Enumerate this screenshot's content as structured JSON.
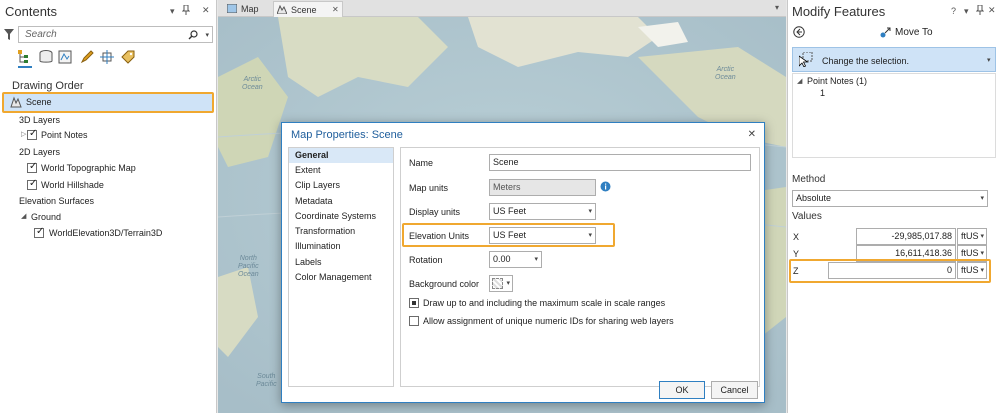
{
  "contents": {
    "title": "Contents",
    "controls": [
      "▾",
      "📌",
      "✕"
    ],
    "search_placeholder": "Search",
    "drawing_order_label": "Drawing Order",
    "scene_label": "Scene",
    "layers": {
      "group_3d": "3D Layers",
      "point_notes": "Point Notes",
      "group_2d": "2D Layers",
      "world_topo": "World Topographic Map",
      "world_hillshade": "World Hillshade",
      "elevation_surfaces": "Elevation Surfaces",
      "ground": "Ground",
      "terrain": "WorldElevation3D/Terrain3D"
    }
  },
  "tabs": [
    {
      "label": "Map"
    },
    {
      "label": "Scene",
      "close": "✕"
    }
  ],
  "map": {
    "labels": {
      "arctic_left": "Arctic\nOcean",
      "arctic_right": "Arctic\nOcean",
      "north_pacific": "North\nPacific\nOcean",
      "south_pacific": "South\nPacific"
    }
  },
  "dialog": {
    "title": "Map Properties: Scene",
    "close": "✕",
    "nav": [
      "General",
      "Extent",
      "Clip Layers",
      "Metadata",
      "Coordinate Systems",
      "Transformation",
      "Illumination",
      "Labels",
      "Color Management"
    ],
    "selected_nav": "General",
    "fields": {
      "name_label": "Name",
      "name_value": "Scene",
      "map_units_label": "Map units",
      "map_units_value": "Meters",
      "display_units_label": "Display units",
      "display_units_value": "US Feet",
      "elevation_units_label": "Elevation Units",
      "elevation_units_value": "US Feet",
      "rotation_label": "Rotation",
      "rotation_value": "0.00",
      "background_color_label": "Background color",
      "checkbox1": "Draw up to and including the maximum scale in scale ranges",
      "checkbox2": "Allow assignment of unique numeric IDs for sharing web layers"
    },
    "ok": "OK",
    "cancel": "Cancel"
  },
  "modify": {
    "title": "Modify Features",
    "controls": [
      "?",
      "▾",
      "📌",
      "✕"
    ],
    "tool": "Move To",
    "change_selection": "Change the selection.",
    "tree_root": "Point Notes (1)",
    "tree_child": "1",
    "method_label": "Method",
    "method_value": "Absolute",
    "values_label": "Values",
    "x_label": "X",
    "x_value": "-29,985,017.88",
    "y_label": "Y",
    "y_value": "16,611,418.36",
    "z_label": "Z",
    "z_value": "0",
    "unit": "ftUS"
  },
  "colors": {
    "highlight": "#f0a830",
    "selection_blue": "#cfe3f7",
    "accent": "#2f7fc1"
  }
}
